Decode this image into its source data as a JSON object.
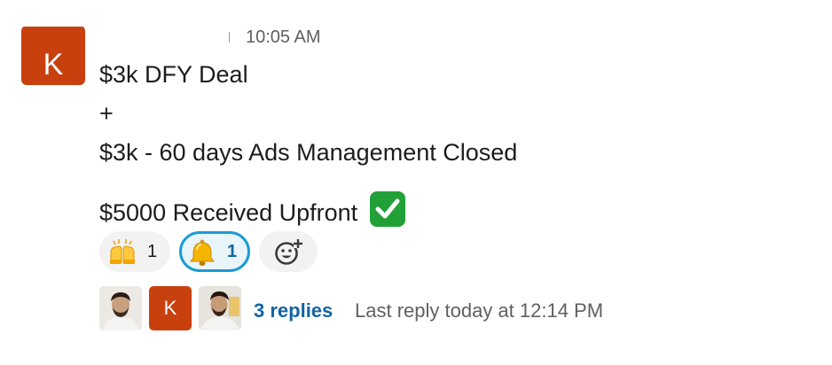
{
  "message": {
    "author_initial": "K",
    "timestamp": "10:05 AM",
    "lines": [
      "$3k DFY Deal",
      "+",
      "$3k - 60 days Ads Management Closed",
      "$5000 Received Upfront"
    ],
    "inline_emoji": "white-check-mark-icon"
  },
  "reactions": [
    {
      "emoji": "raised-hands-icon",
      "count": "1",
      "active": false
    },
    {
      "emoji": "bell-icon",
      "count": "1",
      "active": true
    },
    {
      "emoji": "add-reaction-icon",
      "count": null
    }
  ],
  "thread": {
    "participants": [
      {
        "type": "photo"
      },
      {
        "type": "initial",
        "initial": "K"
      },
      {
        "type": "photo"
      }
    ],
    "replies_label": "3 replies",
    "last_reply": "Last reply today at 12:14 PM"
  },
  "colors": {
    "avatar_bg": "#c9400f",
    "link": "#1264a3",
    "active_reaction_border": "#1d9bd1",
    "active_reaction_bg": "#e8f5fa",
    "muted_text": "#616061"
  }
}
